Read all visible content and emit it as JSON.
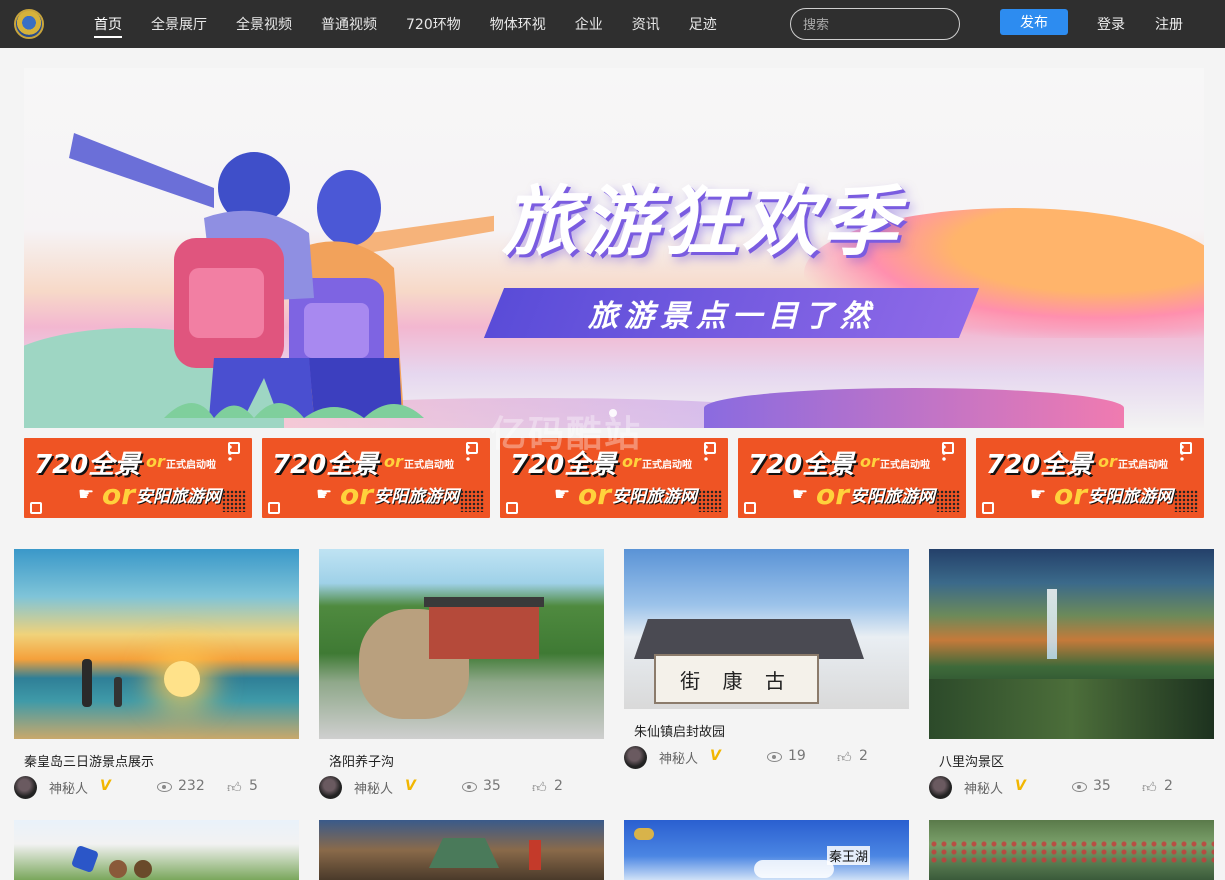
{
  "nav": {
    "items": [
      {
        "label": "首页",
        "active": true
      },
      {
        "label": "全景展厅"
      },
      {
        "label": "全景视频"
      },
      {
        "label": "普通视频"
      },
      {
        "label": "720环物"
      },
      {
        "label": "物体环视"
      },
      {
        "label": "企业"
      },
      {
        "label": "资讯"
      },
      {
        "label": "足迹"
      }
    ],
    "search_placeholder": "搜索",
    "publish_label": "发布",
    "login_label": "登录",
    "register_label": "注册"
  },
  "hero": {
    "title": "旅游狂欢季",
    "subtitle": "旅游景点一目了然"
  },
  "promo": {
    "line1": "720全景",
    "or_small": "or",
    "tag": "正式启动啦",
    "or_big": "or",
    "site": "安阳旅游网"
  },
  "watermark": "亿码酷站",
  "cards": [
    {
      "title": "秦皇岛三日游景点展示",
      "author": "神秘人",
      "views": "232",
      "likes": "5"
    },
    {
      "title": "洛阳养子沟",
      "author": "神秘人",
      "views": "35",
      "likes": "2"
    },
    {
      "title": "朱仙镇启封故园",
      "author": "神秘人",
      "views": "19",
      "likes": "2"
    },
    {
      "title": "八里沟景区",
      "author": "神秘人",
      "views": "35",
      "likes": "2"
    }
  ],
  "thumb_texts": {
    "card3_sign": "街 康 古",
    "bottom3_text": "秦王湖"
  },
  "colors": {
    "topbar": "#2f2f2f",
    "publish": "#2d8cf0",
    "promo": "#ef5424",
    "badge": "#f2b600",
    "ribbon": "#6a55dc"
  },
  "icons": [
    "logo-icon",
    "eye-icon",
    "thumb-up-icon",
    "verified-v-icon",
    "hand-pointer-icon",
    "cube-icon"
  ]
}
